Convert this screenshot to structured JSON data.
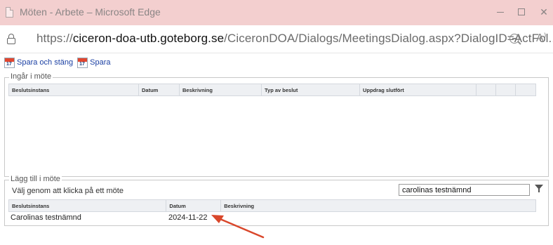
{
  "window": {
    "title": "Möten - Arbete – Microsoft Edge",
    "minimize_glyph": "—",
    "maximize_glyph": "☐",
    "close_glyph": "✕"
  },
  "address": {
    "url_protocol": "https://",
    "url_host": "ciceron-doa-utb.goteborg.se",
    "url_path": "/CiceronDOA/Dialogs/MeetingsDialog.aspx?DialogID=ActFol...",
    "read_aloud_glyph": "A⁾"
  },
  "toolbar": {
    "calendar_number": "17",
    "save_close_label": "Spara och stäng",
    "save_label": "Spara"
  },
  "included_meetings": {
    "legend": "Ingår i möte",
    "columns": [
      "Beslutsinstans",
      "Datum",
      "Beskrivning",
      "Typ av beslut",
      "Uppdrag slutfört",
      "",
      "",
      ""
    ],
    "rows": []
  },
  "add_meeting": {
    "legend": "Lägg till i möte",
    "instruction": "Välj genom att klicka på ett möte",
    "search_value": "carolinas testnämnd",
    "columns": [
      "Beslutsinstans",
      "Datum",
      "Beskrivning"
    ],
    "rows": [
      {
        "beslutsinstans": "Carolinas testnämnd",
        "datum": "2024-11-22",
        "beskrivning": ""
      }
    ]
  },
  "colors": {
    "titlebar": "#f3cfcf",
    "link_blue": "#1a3fa3",
    "annotation_arrow": "#d9472b"
  },
  "icons": {
    "lock": "lock-icon",
    "zoom": "zoom-out-icon",
    "read_aloud": "read-aloud-icon",
    "calendar": "calendar-icon",
    "filter": "filter-icon"
  }
}
